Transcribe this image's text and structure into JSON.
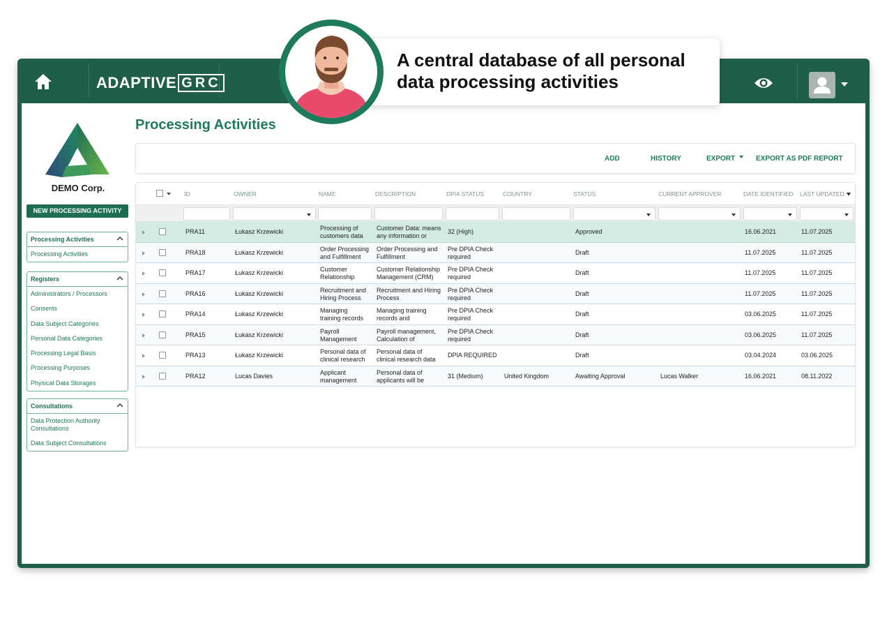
{
  "callout": {
    "line1": "A central database of all personal",
    "line2": "data processing activities"
  },
  "header": {
    "logo_main": "ADAPTIVE",
    "logo_grc": "GRC"
  },
  "sidebar": {
    "company_name": "DEMO Corp.",
    "new_button": "NEW PROCESSING ACTIVITY",
    "panels": [
      {
        "title": "Processing Activities",
        "items": [
          "Processing Activities"
        ]
      },
      {
        "title": "Registers",
        "items": [
          "Administrators / Processors",
          "Consents",
          "Data Subject Categories",
          "Personal Data Categories",
          "Processing Legal Basis",
          "Processing Purposes",
          "Physical Data Storages"
        ]
      },
      {
        "title": "Consultations",
        "items": [
          "Data Protection Authority Consultations",
          "Data Subject Consultations"
        ]
      }
    ]
  },
  "main": {
    "title": "Processing Activities",
    "toolbar": {
      "add": "ADD",
      "history": "HISTORY",
      "export": "EXPORT",
      "export_pdf": "EXPORT AS PDF REPORT"
    },
    "columns": [
      "ID",
      "OWNER",
      "NAME",
      "DESCRIPTION",
      "DPIA STATUS",
      "COUNTRY",
      "STATUS",
      "CURRENT APPROVER",
      "DATE IDENTIFIED",
      "LAST UPDATED"
    ],
    "rows": [
      {
        "id": "PRA11",
        "owner": "Łukasz Krzewicki",
        "name": [
          "Processing of",
          "customers data"
        ],
        "description": [
          "Customer Data: means",
          "any information or"
        ],
        "dpia": [
          "32 (High)"
        ],
        "country": "",
        "status": "Approved",
        "approver": "",
        "date_identified": "16.06.2021",
        "last_updated": "11.07.2025"
      },
      {
        "id": "PRA18",
        "owner": "Łukasz Krzewicki",
        "name": [
          "Order Processing",
          "and Fulfillment"
        ],
        "description": [
          "Order Processing and",
          "Fulfillment"
        ],
        "dpia": [
          "Pre DPIA Check",
          "required"
        ],
        "country": "",
        "status": "Draft",
        "approver": "",
        "date_identified": "11.07.2025",
        "last_updated": "11.07.2025"
      },
      {
        "id": "PRA17",
        "owner": "Łukasz Krzewicki",
        "name": [
          "Customer",
          "Relationship"
        ],
        "description": [
          "Customer Relationship",
          "Management (CRM)"
        ],
        "dpia": [
          "Pre DPIA Check",
          "required"
        ],
        "country": "",
        "status": "Draft",
        "approver": "",
        "date_identified": "11.07.2025",
        "last_updated": "11.07.2025"
      },
      {
        "id": "PRA16",
        "owner": "Łukasz Krzewicki",
        "name": [
          "Recruitment and",
          "Hiring Process"
        ],
        "description": [
          "Recruitment and Hiring",
          "Process"
        ],
        "dpia": [
          "Pre DPIA Check",
          "required"
        ],
        "country": "",
        "status": "Draft",
        "approver": "",
        "date_identified": "11.07.2025",
        "last_updated": "11.07.2025"
      },
      {
        "id": "PRA14",
        "owner": "Łukasz Krzewicki",
        "name": [
          "Managing",
          "training records"
        ],
        "description": [
          "Managing training",
          "records and"
        ],
        "dpia": [
          "Pre DPIA Check",
          "required"
        ],
        "country": "",
        "status": "Draft",
        "approver": "",
        "date_identified": "03.06.2025",
        "last_updated": "11.07.2025"
      },
      {
        "id": "PRA15",
        "owner": "Łukasz Krzewicki",
        "name": [
          "Payroll",
          "Management"
        ],
        "description": [
          "Payroll management,",
          "Calculation of"
        ],
        "dpia": [
          "Pre DPIA Check",
          "required"
        ],
        "country": "",
        "status": "Draft",
        "approver": "",
        "date_identified": "03.06.2025",
        "last_updated": "11.07.2025"
      },
      {
        "id": "PRA13",
        "owner": "Łukasz Krzewicki",
        "name": [
          "Personal data of",
          "clinical research"
        ],
        "description": [
          "Personal data of",
          "clinical research data"
        ],
        "dpia": [
          "DPIA REQUIRED"
        ],
        "country": "",
        "status": "Draft",
        "approver": "",
        "date_identified": "03.04.2024",
        "last_updated": "03.06.2025"
      },
      {
        "id": "PRA12",
        "owner": "Lucas Davies",
        "name": [
          "Applicant",
          "management"
        ],
        "description": [
          "Personal data of",
          "applicants will be"
        ],
        "dpia": [
          "31 (Medium)"
        ],
        "country": "United Kingdom",
        "status": "Awaiting Approval",
        "approver": "Lucas Walker",
        "date_identified": "16.06.2021",
        "last_updated": "08.11.2022"
      }
    ]
  },
  "colors": {
    "brand_dark": "#1e5e4b",
    "brand_green": "#1e7a5c",
    "selected_row": "#d3ebe3",
    "callout_ring": "#1e7a5c"
  },
  "icons": [
    "home-icon",
    "eye-icon",
    "user-icon",
    "chevron-up-icon",
    "caret-down-icon",
    "expand-arrow-icon",
    "checkbox-icon",
    "company-logo-icon",
    "person-avatar-icon"
  ]
}
